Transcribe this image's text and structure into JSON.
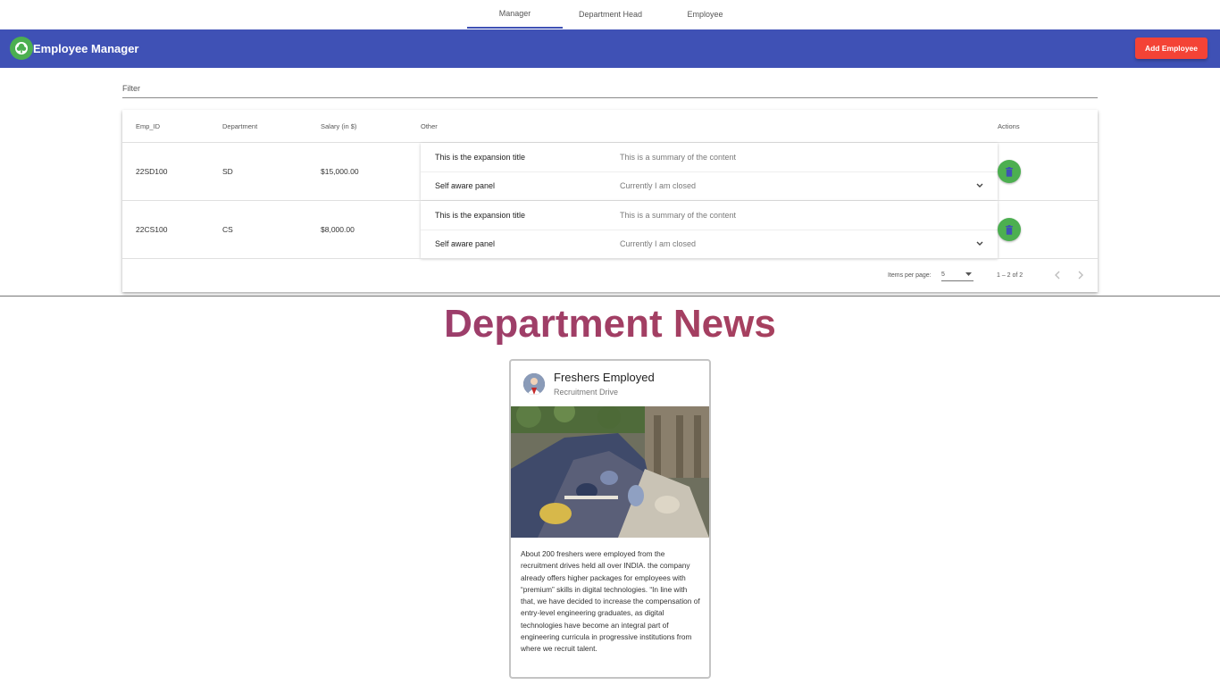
{
  "tabs": [
    {
      "label": "Manager",
      "active": true
    },
    {
      "label": "Department Head",
      "active": false
    },
    {
      "label": "Employee",
      "active": false
    }
  ],
  "appbar": {
    "title": "Employee Manager",
    "logo_icon": "tree-icon",
    "add_button_label": "Add Employee",
    "colors": {
      "primary": "#3f51b5",
      "accent": "#f44336",
      "logo": "#4caf50"
    }
  },
  "filter": {
    "placeholder": "Filter",
    "value": ""
  },
  "table": {
    "headers": {
      "id": "Emp_ID",
      "department": "Department",
      "salary": "Salary (in $)",
      "other": "Other",
      "actions": "Actions"
    },
    "rows": [
      {
        "id": "22SD100",
        "department": "SD",
        "salary": "$15,000.00",
        "panel": {
          "title": "This is the expansion title",
          "summary": "This is a summary of the content",
          "self_aware_title": "Self aware panel",
          "self_aware_state": "Currently I am closed"
        }
      },
      {
        "id": "22CS100",
        "department": "CS",
        "salary": "$8,000.00",
        "panel": {
          "title": "This is the expansion title",
          "summary": "This is a summary of the content",
          "self_aware_title": "Self aware panel",
          "self_aware_state": "Currently I am closed"
        }
      }
    ],
    "paginator": {
      "items_per_page_label": "Items per page:",
      "page_size": "5",
      "range_label": "1 – 2 of 2"
    }
  },
  "news": {
    "heading": "Department News",
    "card": {
      "title": "Freshers Employed",
      "subtitle": "Recruitment Drive",
      "body": "About 200 freshers were employed from the recruitment drives held all over INDIA. the company already offers higher packages for employees with “premium” skills in digital technologies. “In line with that, we have decided to increase the compensation of entry-level engineering graduates, as digital technologies have become an integral part of engineering curricula in progressive institutions from where we recruit talent."
    }
  }
}
